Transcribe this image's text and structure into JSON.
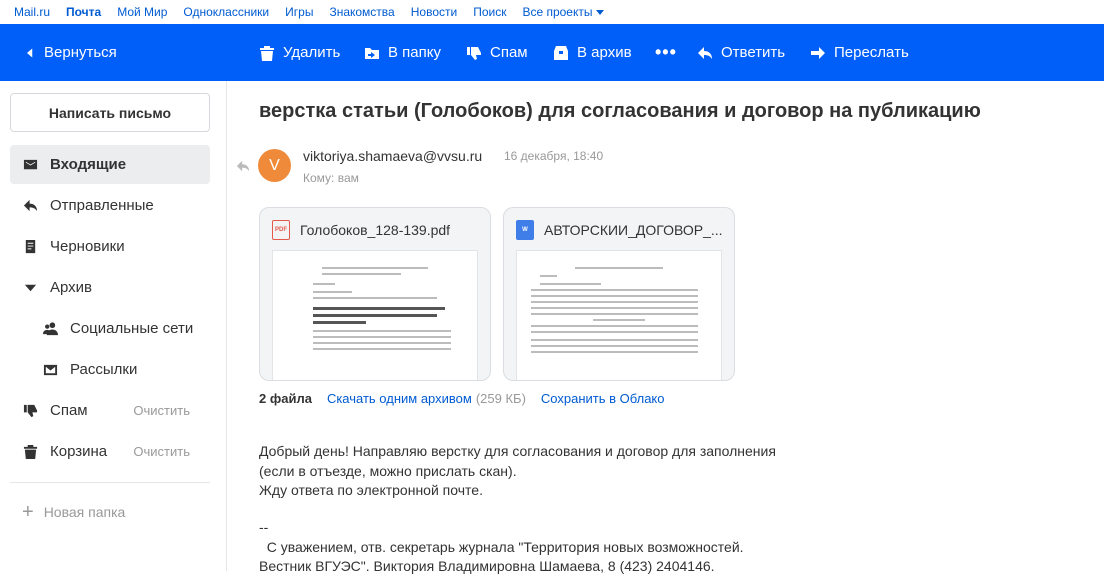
{
  "portal": {
    "links": [
      "Mail.ru",
      "Почта",
      "Мой Мир",
      "Одноклассники",
      "Игры",
      "Знакомства",
      "Новости",
      "Поиск",
      "Все проекты"
    ]
  },
  "toolbar": {
    "back": "Вернуться",
    "delete": "Удалить",
    "move": "В папку",
    "spam": "Спам",
    "archive": "В архив",
    "more": "•••",
    "reply": "Ответить",
    "forward": "Переслать"
  },
  "sidebar": {
    "compose": "Написать письмо",
    "items": [
      {
        "label": "Входящие",
        "icon": "inbox-icon"
      },
      {
        "label": "Отправленные",
        "icon": "sent-icon"
      },
      {
        "label": "Черновики",
        "icon": "drafts-icon"
      },
      {
        "label": "Архив",
        "icon": "caret-down-icon"
      },
      {
        "label": "Социальные сети",
        "icon": "people-icon"
      },
      {
        "label": "Рассылки",
        "icon": "newsletter-icon"
      },
      {
        "label": "Спам",
        "icon": "spam-icon",
        "action": "Очистить"
      },
      {
        "label": "Корзина",
        "icon": "trash-icon",
        "action": "Очистить"
      }
    ],
    "new_folder": "Новая папка"
  },
  "message": {
    "subject": "верстка статьи (Голобоков) для согласования и договор на публикацию",
    "avatar_letter": "V",
    "sender": "viktoriya.shamaeva@vvsu.ru",
    "date": "16 декабря, 18:40",
    "to": "Кому: вам",
    "attachments": [
      {
        "name": "Голобоков_128-139.pdf",
        "type": "PDF"
      },
      {
        "name": "АВТОРСКИИ_ДОГОВОР_...",
        "type": "W"
      }
    ],
    "attachments_count": "2 файла",
    "download_all": "Скачать одним архивом",
    "archive_size": "(259 КБ)",
    "save_cloud": "Сохранить в Облако",
    "body": "Добрый день! Направляю верстку для согласования и договор для заполнения\n(если в отъезде, можно прислать скан).\nЖду ответа по электронной почте.",
    "signature": "--\n  С уважением, отв. секретарь журнала \"Территория новых возможностей.\nВестник ВГУЭС\". Виктория Владимировна Шамаева, 8 (423) 2404146."
  },
  "colors": {
    "toolbar_bg": "#005ff9",
    "link": "#005bd1",
    "avatar": "#ef8a3a"
  }
}
